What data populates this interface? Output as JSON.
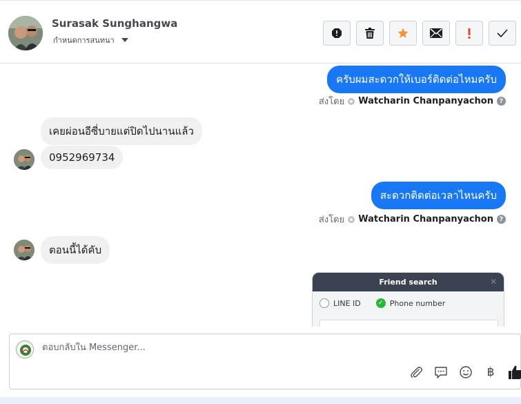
{
  "header": {
    "contact_name": "Surasak Sunghangwa",
    "label_select": "กำหนดการสนทนา",
    "actions": [
      {
        "name": "alert-icon"
      },
      {
        "name": "trash-icon"
      },
      {
        "name": "star-icon"
      },
      {
        "name": "envelope-icon"
      },
      {
        "name": "exclamation-icon"
      },
      {
        "name": "check-icon"
      }
    ]
  },
  "thread": {
    "messages": [
      {
        "direction": "out",
        "text": "ครับผมสะดวกให้เบอร์ติดต่อไหมครับ"
      },
      {
        "direction": "out-meta",
        "prefix": "ส่งโดย",
        "sender": "Watcharin Chanpanyachon"
      },
      {
        "direction": "in",
        "text": "เคยผ่อนอีซี่บายแต่ปิดไปนานแล้ว"
      },
      {
        "direction": "in",
        "text": "0952969734"
      },
      {
        "direction": "out",
        "text": "สะดวกติดต่อเวลาไหนครับ"
      },
      {
        "direction": "out-meta",
        "prefix": "ส่งโดย",
        "sender": "Watcharin Chanpanyachon"
      },
      {
        "direction": "in",
        "text": "ตอนนี้ได้คับ"
      }
    ],
    "attachment": {
      "title": "Friend search",
      "option_1": "LINE ID",
      "option_2": "Phone number"
    }
  },
  "composer": {
    "placeholder": "ตอบกลับใน Messenger...",
    "currency_symbol": "฿"
  },
  "colors": {
    "accent": "#1877f2",
    "incoming_bubble": "#f0f0f0",
    "star": "#f7923a",
    "alert": "#e64530"
  }
}
